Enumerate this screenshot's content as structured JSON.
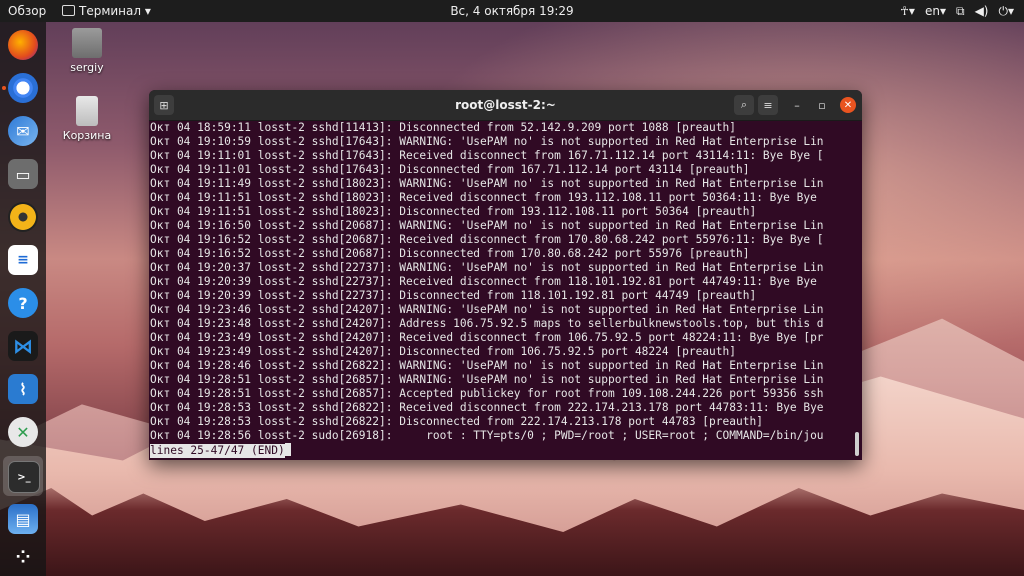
{
  "topbar": {
    "overview": "Обзор",
    "app_name": "Терминал",
    "clock": "Вс, 4 октября  19:29",
    "lang": "en"
  },
  "desktop": {
    "home_label": "sergiy",
    "trash_label": "Корзина"
  },
  "window": {
    "title": "root@losst-2:~"
  },
  "terminal": {
    "lines": [
      "Окт 04 18:59:11 losst-2 sshd[11413]: Disconnected from 52.142.9.209 port 1088 [preauth]",
      "Окт 04 19:10:59 losst-2 sshd[17643]: WARNING: 'UsePAM no' is not supported in Red Hat Enterprise Lin",
      "Окт 04 19:11:01 losst-2 sshd[17643]: Received disconnect from 167.71.112.14 port 43114:11: Bye Bye [",
      "Окт 04 19:11:01 losst-2 sshd[17643]: Disconnected from 167.71.112.14 port 43114 [preauth]",
      "Окт 04 19:11:49 losst-2 sshd[18023]: WARNING: 'UsePAM no' is not supported in Red Hat Enterprise Lin",
      "Окт 04 19:11:51 losst-2 sshd[18023]: Received disconnect from 193.112.108.11 port 50364:11: Bye Bye",
      "Окт 04 19:11:51 losst-2 sshd[18023]: Disconnected from 193.112.108.11 port 50364 [preauth]",
      "Окт 04 19:16:50 losst-2 sshd[20687]: WARNING: 'UsePAM no' is not supported in Red Hat Enterprise Lin",
      "Окт 04 19:16:52 losst-2 sshd[20687]: Received disconnect from 170.80.68.242 port 55976:11: Bye Bye [",
      "Окт 04 19:16:52 losst-2 sshd[20687]: Disconnected from 170.80.68.242 port 55976 [preauth]",
      "Окт 04 19:20:37 losst-2 sshd[22737]: WARNING: 'UsePAM no' is not supported in Red Hat Enterprise Lin",
      "Окт 04 19:20:39 losst-2 sshd[22737]: Received disconnect from 118.101.192.81 port 44749:11: Bye Bye",
      "Окт 04 19:20:39 losst-2 sshd[22737]: Disconnected from 118.101.192.81 port 44749 [preauth]",
      "Окт 04 19:23:46 losst-2 sshd[24207]: WARNING: 'UsePAM no' is not supported in Red Hat Enterprise Lin",
      "Окт 04 19:23:48 losst-2 sshd[24207]: Address 106.75.92.5 maps to sellerbulknewstools.top, but this d",
      "Окт 04 19:23:49 losst-2 sshd[24207]: Received disconnect from 106.75.92.5 port 48224:11: Bye Bye [pr",
      "Окт 04 19:23:49 losst-2 sshd[24207]: Disconnected from 106.75.92.5 port 48224 [preauth]",
      "Окт 04 19:28:46 losst-2 sshd[26822]: WARNING: 'UsePAM no' is not supported in Red Hat Enterprise Lin",
      "Окт 04 19:28:51 losst-2 sshd[26857]: WARNING: 'UsePAM no' is not supported in Red Hat Enterprise Lin",
      "Окт 04 19:28:51 losst-2 sshd[26857]: Accepted publickey for root from 109.108.244.226 port 59356 ssh",
      "Окт 04 19:28:53 losst-2 sshd[26822]: Received disconnect from 222.174.213.178 port 44783:11: Bye Bye",
      "Окт 04 19:28:53 losst-2 sshd[26822]: Disconnected from 222.174.213.178 port 44783 [preauth]",
      "Окт 04 19:28:56 losst-2 sudo[26918]:     root : TTY=pts/0 ; PWD=/root ; USER=root ; COMMAND=/bin/jou"
    ],
    "status": "lines 25-47/47 (END)"
  },
  "colors": {
    "terminal_bg": "#300a24",
    "accent": "#e95420"
  }
}
